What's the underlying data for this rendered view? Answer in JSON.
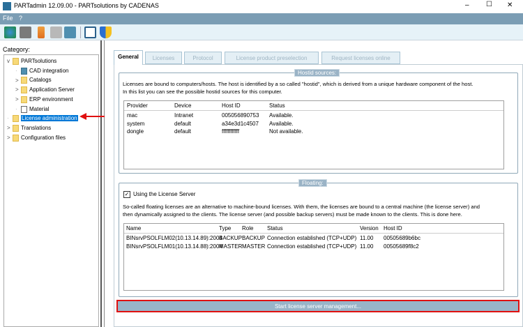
{
  "window": {
    "title": "PARTadmin 12.09.00 - PARTsolutions by CADENAS",
    "minimize": "–",
    "maximize": "☐",
    "close": "✕"
  },
  "menu": {
    "file": "File",
    "help": "?"
  },
  "toolbar": {
    "icons": [
      "refresh-globe-icon",
      "tools-icon",
      "hierarchy-icon",
      "keys-icon",
      "settings-panel-icon",
      "save-icon",
      "shield-icon"
    ]
  },
  "category": {
    "label": "Category:",
    "tree": [
      {
        "label": "PARTsolutions",
        "level": 0,
        "icon": "folder",
        "expander": "v"
      },
      {
        "label": "CAD integration",
        "level": 1,
        "icon": "cad",
        "expander": ""
      },
      {
        "label": "Catalogs",
        "level": 1,
        "icon": "folder",
        "expander": ">"
      },
      {
        "label": "Application Server",
        "level": 1,
        "icon": "folder",
        "expander": ">"
      },
      {
        "label": "ERP environment",
        "level": 1,
        "icon": "folder",
        "expander": ">"
      },
      {
        "label": "Material",
        "level": 1,
        "icon": "document",
        "expander": ""
      },
      {
        "label": "License administration",
        "level": 0,
        "icon": "folder",
        "expander": "",
        "selected": true
      },
      {
        "label": "Translations",
        "level": 0,
        "icon": "folder",
        "expander": ">"
      },
      {
        "label": "Configuration files",
        "level": 0,
        "icon": "folder",
        "expander": ">"
      }
    ]
  },
  "tabs": [
    "General",
    "Licenses",
    "Protocol",
    "License product preselection",
    "Request licenses online"
  ],
  "hostid": {
    "title": "Hostid sources:",
    "description1": "Licenses are bound to computers/hosts. The host is identified by a so called \"hostid\", which is derived from a unique hardware component of the host.",
    "description2": "In this list you can see the possible hostid sources for this computer.",
    "columns": [
      "Provider",
      "Device",
      "Host ID",
      "Status"
    ],
    "rows": [
      [
        "mac",
        "Intranet",
        "005056890753",
        "Available."
      ],
      [
        "system",
        "default",
        "a34e3d1c4507",
        "Available."
      ],
      [
        "dongle",
        "default",
        "ffffffffffff",
        "Not available."
      ]
    ]
  },
  "floating": {
    "title": "Floating:",
    "checkbox_label": "Using the License Server",
    "checked": true,
    "description1": "So-called floating licenses are an alternative to machine-bound licenses. With them, the licenses are bound to a central machine (the license server) and",
    "description2": "then dynamically assigned to the clients. The license server (and possible backup servers) must be made known to the clients. This is done here.",
    "columns": [
      "Name",
      "Type",
      "Role",
      "Status",
      "Version",
      "Host ID"
    ],
    "rows": [
      [
        "BINsrvPSOLFLM02(10.13.14.89):2004",
        "BACKUP",
        "BACKUP",
        "Connection established (TCP+UDP)",
        "11.00",
        "00505689b6bc"
      ],
      [
        "BINsrvPSOLFLM01(10.13.14.88):2004",
        "MASTER",
        "MASTER",
        "Connection established (TCP+UDP)",
        "11.00",
        "00505689f8c2"
      ]
    ]
  },
  "start_button": "Start license server management...",
  "colors": {
    "menubar": "#7b9db4",
    "highlight": "#e01010",
    "selection": "#0078d7"
  }
}
